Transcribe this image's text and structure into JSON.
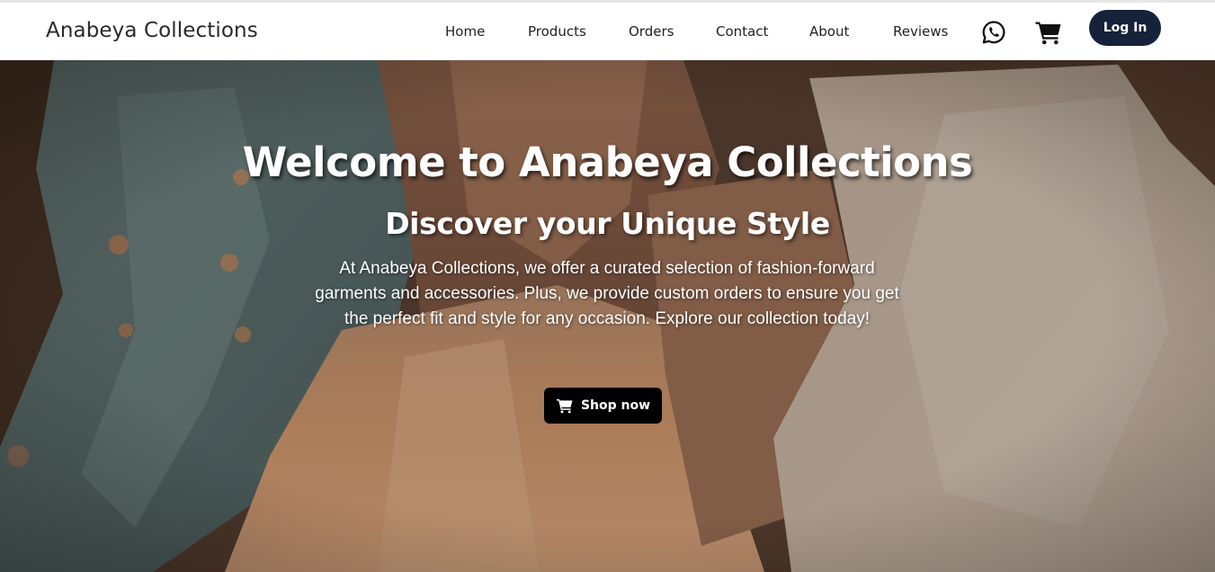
{
  "navbar": {
    "brand": "Anabeya Collections",
    "links": [
      {
        "label": "Home"
      },
      {
        "label": "Products"
      },
      {
        "label": "Orders"
      },
      {
        "label": "Contact"
      },
      {
        "label": "About"
      },
      {
        "label": "Reviews"
      }
    ],
    "whatsapp_icon": "whatsapp-icon",
    "cart_icon": "cart-icon",
    "login_label": "Log In"
  },
  "hero": {
    "title": "Welcome to Anabeya Collections",
    "subtitle": "Discover your Unique Style",
    "description": "At Anabeya Collections, we offer a curated selection of fashion-forward garments and accessories. Plus, we provide custom orders to ensure you get the perfect fit and style for any occasion. Explore our collection today!",
    "shop_label": "Shop now",
    "shop_icon": "cart-icon",
    "background": "clothing-photo"
  },
  "colors": {
    "login_bg": "#16223a",
    "shop_bg": "#000000",
    "nav_bg": "#ffffff"
  }
}
